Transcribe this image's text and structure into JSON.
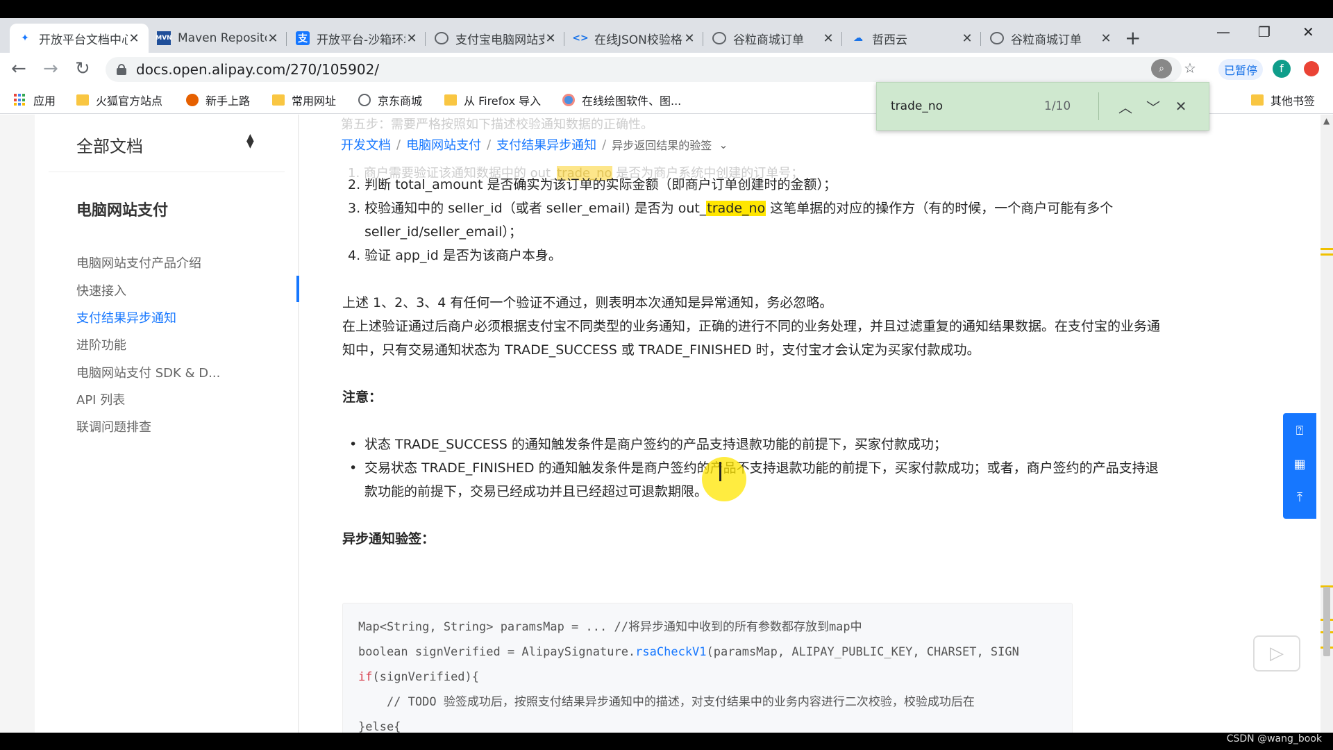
{
  "tabs": [
    {
      "title": "开放平台文档中心",
      "icon": "alipay-doc-icon"
    },
    {
      "title": "Maven Repository",
      "icon": "maven-icon"
    },
    {
      "title": "开放平台-沙箱环境",
      "icon": "alipay-icon"
    },
    {
      "title": "支付宝电脑网站支付",
      "icon": "globe-icon"
    },
    {
      "title": "在线JSON校验格式化",
      "icon": "code-icon"
    },
    {
      "title": "谷粒商城订单",
      "icon": "globe-icon"
    },
    {
      "title": "哲西云",
      "icon": "cloud-icon"
    },
    {
      "title": "谷粒商城订单",
      "icon": "globe-icon"
    }
  ],
  "toolbar": {
    "url": "docs.open.alipay.com/270/105902/",
    "paused_label": "已暂停",
    "profile_letter": "f"
  },
  "bookmarks": [
    {
      "label": "应用"
    },
    {
      "label": "火狐官方站点"
    },
    {
      "label": "新手上路"
    },
    {
      "label": "常用网址"
    },
    {
      "label": "京东商城"
    },
    {
      "label": "从 Firefox 导入"
    },
    {
      "label": "在线绘图软件、图..."
    },
    {
      "label": "其他书签"
    }
  ],
  "findbar": {
    "query": "trade_no",
    "count": "1/10"
  },
  "sidebar": {
    "header": "全部文档",
    "section": "电脑网站支付",
    "items": [
      {
        "label": "电脑网站支付产品介绍"
      },
      {
        "label": "快速接入"
      },
      {
        "label": "支付结果异步通知"
      },
      {
        "label": "进阶功能"
      },
      {
        "label": "电脑网站支付 SDK & D..."
      },
      {
        "label": "API 列表"
      },
      {
        "label": "联调问题排查"
      }
    ]
  },
  "breadcrumb": {
    "items": [
      "开发文档",
      "电脑网站支付",
      "支付结果异步通知"
    ],
    "current": "异步返回结果的验签"
  },
  "content": {
    "faded_top": "第五步：需要严格按照如下描述校验通知数据的正确性。",
    "faded_line_a": "1. 商户需要验证该通知数据中的 out_",
    "faded_line_hl": "trade_no",
    "faded_line_b": " 是否为商户系统中创建的订单号；",
    "item2": "2. 判断 total_amount 是否确实为该订单的实际金额（即商户订单创建时的金额）；",
    "item3_a": "3. 校验通知中的 seller_id（或者 seller_email) 是否为 out_",
    "item3_hl": "trade_no",
    "item3_b": " 这笔单据的对应的操作方（有的时候，一个商户可能有多个",
    "item3_c": "seller_id/seller_email）；",
    "item4": "4. 验证 app_id 是否为该商户本身。",
    "para1": "上述 1、2、3、4 有任何一个验证不通过，则表明本次通知是异常通知，务必忽略。",
    "para2a": "在上述验证通过后商户必须根据支付宝不同类型的业务通知，正确的进行不同的业务处理，并且过滤重复的通知结果数据。在支付宝的业务通",
    "para2b": "知中，只有交易通知状态为 TRADE_SUCCESS 或 TRADE_FINISHED 时，支付宝才会认定为买家付款成功。",
    "note_title": "注意：",
    "bullet1": "状态 TRADE_SUCCESS 的通知触发条件是商户签约的产品支持退款功能的前提下，买家付款成功；",
    "bullet2a": "交易状态 TRADE_FINISHED 的通知触发条件是商户签约的产品不支持退款功能的前提下，买家付款成功；或者，商户签约的产品支持退",
    "bullet2b": "款功能的前提下，交易已经成功并且已经超过可退款期限。",
    "verify_title": "异步通知验签："
  },
  "code": {
    "line1_a": "Map<String, String> paramsMap = ... ",
    "line1_b": "//将异步通知中收到的所有参数都存放到map中",
    "line2_a": "boolean signVerified = AlipaySignature.",
    "line2_fn": "rsaCheckV1",
    "line2_b": "(paramsMap, ALIPAY_PUBLIC_KEY, CHARSET, SIGN",
    "line3_kw": "if",
    "line3_b": "(signVerified){",
    "line4": "    // TODO 验签成功后，按照支付结果异步通知中的描述，对支付结果中的业务内容进行二次校验，校验成功后在",
    "line5": "}else{"
  },
  "watermark": "CSDN @wang_book",
  "colors": {
    "link": "#1677ff",
    "highlight": "#ffe600",
    "findbar": "#cfe8cf"
  }
}
